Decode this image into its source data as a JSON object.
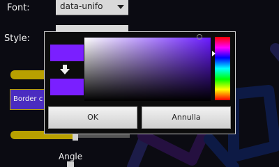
{
  "background": {
    "font_label": "Font:",
    "font_select_value": "data-unifo",
    "style_label": "Style:",
    "border_button_label": "Border c",
    "angle_label": "Angle"
  },
  "color_picker": {
    "old_color": "#7a1fff",
    "new_color": "#7a1fff",
    "arrow_icon": "down-arrow-icon",
    "ok_label": "OK",
    "cancel_label": "Annulla"
  },
  "colors": {
    "accent_purple": "#7a1fff",
    "background_yellow": "#b8a000",
    "border_button_bg": "#4a2cc0"
  }
}
